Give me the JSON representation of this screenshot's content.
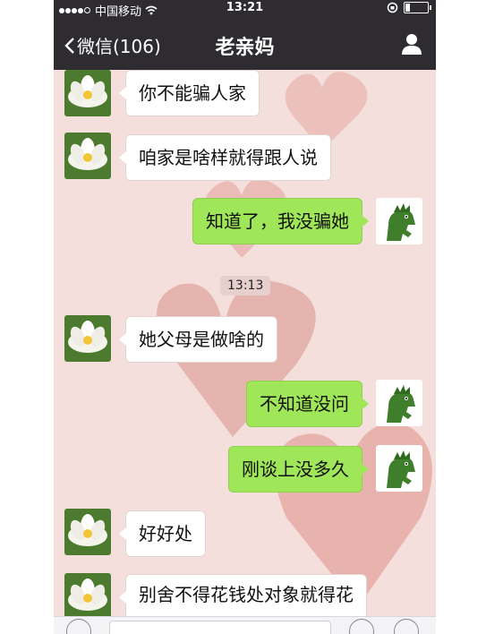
{
  "status_bar": {
    "carrier": "中国移动",
    "time": "13:21"
  },
  "header": {
    "back_label": "微信(106)",
    "title": "老亲妈"
  },
  "messages": [
    {
      "side": "in",
      "text": "你不能骗人家"
    },
    {
      "side": "in",
      "text": "咱家是啥样就得跟人说"
    },
    {
      "side": "out",
      "text": "知道了，我没骗她"
    },
    {
      "side": "in",
      "text": "她父母是做啥的"
    },
    {
      "side": "out",
      "text": "不知道没问"
    },
    {
      "side": "out",
      "text": "刚谈上没多久"
    },
    {
      "side": "in",
      "text": "好好处"
    },
    {
      "side": "in",
      "text": "别舍不得花钱处对象就得花"
    }
  ],
  "timestamp": "13:13",
  "colors": {
    "header_bg": "#2e2c31",
    "sent_bubble": "#9fe658",
    "received_bubble": "#ffffff",
    "chat_bg": "#f5dfdc"
  },
  "icons": [
    "chevron-left-icon",
    "wifi-icon",
    "battery-icon",
    "person-icon",
    "lotus-avatar",
    "dinosaur-avatar"
  ]
}
